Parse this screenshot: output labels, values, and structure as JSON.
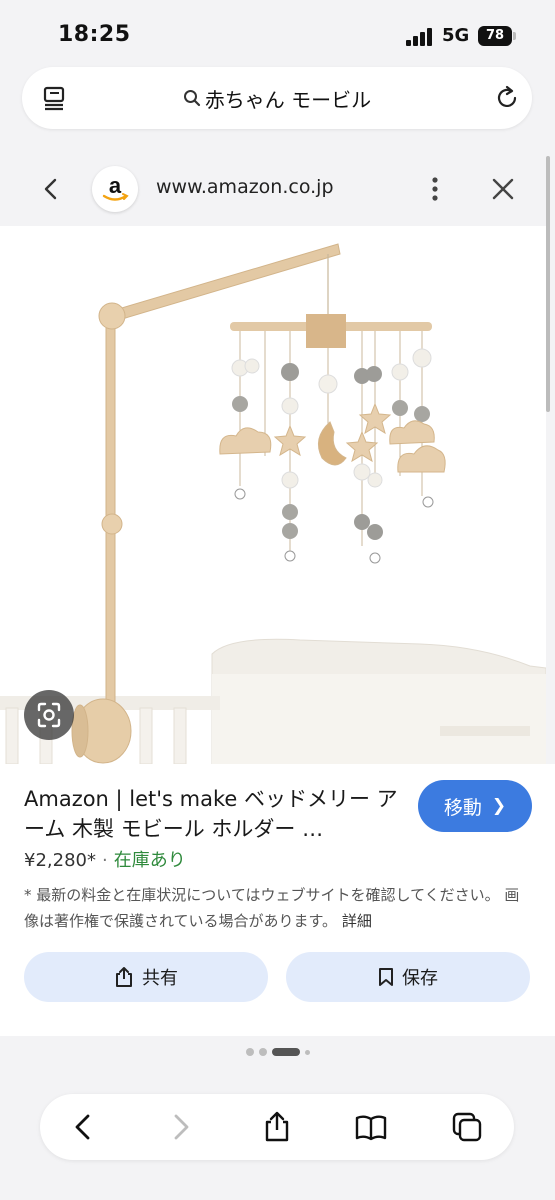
{
  "status_bar": {
    "time": "18:25",
    "network": "5G",
    "battery": "78"
  },
  "search": {
    "query": "赤ちゃん モービル"
  },
  "site": {
    "url": "www.amazon.co.jp",
    "logo_letter": "a"
  },
  "product": {
    "title": "Amazon | let's make ベッドメリー アーム 木製 モビール ホルダー …",
    "price": "¥2,280*",
    "separator": "·",
    "stock": "在庫あり",
    "disclaimer": "* 最新の料金と在庫状況についてはウェブサイトを確認してください。 画像は著作権で保護されている場合があります。",
    "details_link": "詳細"
  },
  "buttons": {
    "visit": "移動",
    "share": "共有",
    "save": "保存"
  },
  "icons": {
    "tabs": "tab-list-icon",
    "reload": "reload-icon",
    "back": "chevron-left-icon",
    "more": "more-vertical-icon",
    "close": "close-icon",
    "lens": "lens-icon",
    "share": "share-icon",
    "save": "bookmark-icon"
  },
  "colors": {
    "accent": "#3c7be0",
    "stock": "#2f8a3c",
    "action_bg": "#e2ebfb"
  }
}
